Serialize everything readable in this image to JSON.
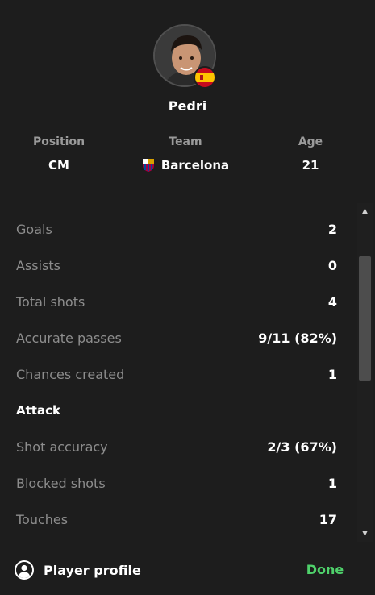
{
  "player": {
    "name": "Pedri",
    "flag_icon": "spain-flag-icon",
    "avatar_icon": "player-photo-avatar"
  },
  "info": {
    "position_label": "Position",
    "position_value": "CM",
    "team_label": "Team",
    "team_value": "Barcelona",
    "team_icon": "barcelona-crest-icon",
    "age_label": "Age",
    "age_value": "21"
  },
  "stats": [
    {
      "label": "Goals",
      "value": "2"
    },
    {
      "label": "Assists",
      "value": "0"
    },
    {
      "label": "Total shots",
      "value": "4"
    },
    {
      "label": "Accurate passes",
      "value": "9/11 (82%)"
    },
    {
      "label": "Chances created",
      "value": "1"
    }
  ],
  "attack_section": {
    "title": "Attack",
    "stats": [
      {
        "label": "Shot accuracy",
        "value": "2/3 (67%)"
      },
      {
        "label": "Blocked shots",
        "value": "1"
      },
      {
        "label": "Touches",
        "value": "17"
      }
    ]
  },
  "footer": {
    "profile_label": "Player profile",
    "profile_icon": "user-circle-icon",
    "done_label": "Done"
  },
  "colors": {
    "background": "#1d1d1d",
    "muted_text": "#8d8d8d",
    "accent_green": "#4fd16b"
  }
}
